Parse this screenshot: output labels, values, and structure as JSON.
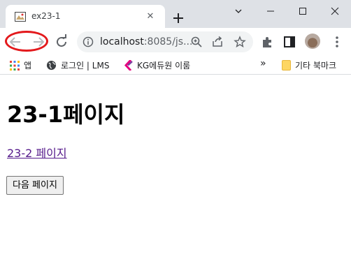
{
  "tab": {
    "title": "ex23-1",
    "close_glyph": "✕"
  },
  "window_controls": [
    "minimize",
    "maximize",
    "close"
  ],
  "toolbar": {
    "url_host": "localhost",
    "url_rest": ":8085/js..."
  },
  "bookmarks": {
    "items": [
      {
        "label": "앱",
        "icon": "apps-grid-icon"
      },
      {
        "label": "로그인 | LMS",
        "icon": "globe-icon"
      },
      {
        "label": "KG에듀원 이룸",
        "icon": "kg-logo-icon"
      }
    ],
    "overflow_glyph": "»",
    "other_bookmarks": "기타 북마크"
  },
  "page": {
    "heading": "23-1페이지",
    "link_text": "23-2 페이지",
    "button_label": "다음 페이지"
  },
  "colors": {
    "tabstrip_bg": "#dee1e6",
    "annotation_red": "#e3191c",
    "visited_link": "#551a8b"
  }
}
